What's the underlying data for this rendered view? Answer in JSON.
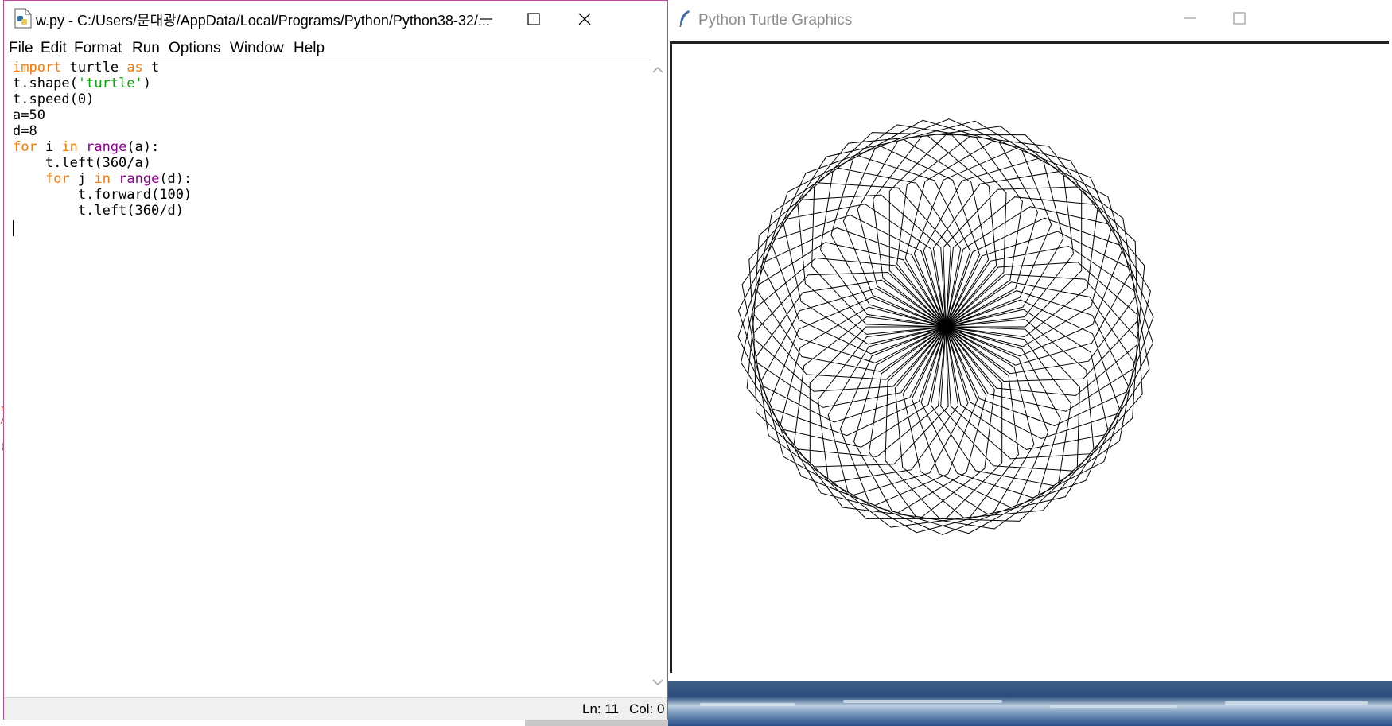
{
  "editor": {
    "title": "w.py - C:/Users/문대광/AppData/Local/Programs/Python/Python38-32/...",
    "menu": [
      "File",
      "Edit",
      "Format",
      "Run",
      "Options",
      "Window",
      "Help"
    ],
    "code": [
      [
        {
          "t": "import",
          "c": "kw"
        },
        {
          "t": " turtle "
        },
        {
          "t": "as",
          "c": "kw"
        },
        {
          "t": " t"
        }
      ],
      [
        {
          "t": "t.shape("
        },
        {
          "t": "'turtle'",
          "c": "str"
        },
        {
          "t": ")"
        }
      ],
      [
        {
          "t": "t.speed(0)"
        }
      ],
      [
        {
          "t": "a=50"
        }
      ],
      [
        {
          "t": "d=8"
        }
      ],
      [
        {
          "t": "for",
          "c": "kw"
        },
        {
          "t": " i "
        },
        {
          "t": "in",
          "c": "kw"
        },
        {
          "t": " "
        },
        {
          "t": "range",
          "c": "bi"
        },
        {
          "t": "(a):"
        }
      ],
      [
        {
          "t": "    t.left(360/a)"
        }
      ],
      [
        {
          "t": "    "
        },
        {
          "t": "for",
          "c": "kw"
        },
        {
          "t": " j "
        },
        {
          "t": "in",
          "c": "kw"
        },
        {
          "t": " "
        },
        {
          "t": "range",
          "c": "bi"
        },
        {
          "t": "(d):"
        }
      ],
      [
        {
          "t": "        t.forward(100)"
        }
      ],
      [
        {
          "t": "        t.left(360/d)"
        }
      ]
    ],
    "status": {
      "ln": "Ln: 11",
      "col": "Col: 0"
    }
  },
  "turtle_window": {
    "title": "Python Turtle Graphics",
    "drawing": {
      "repetitions": 50,
      "sides": 8,
      "step": 100,
      "turn_per_repetition_deg": 7.2,
      "line_color": "#000000"
    }
  },
  "colors": {
    "keyword": "#ff7700",
    "builtin": "#900090",
    "string": "#00aa00",
    "editor_border": "#c04a9a"
  }
}
